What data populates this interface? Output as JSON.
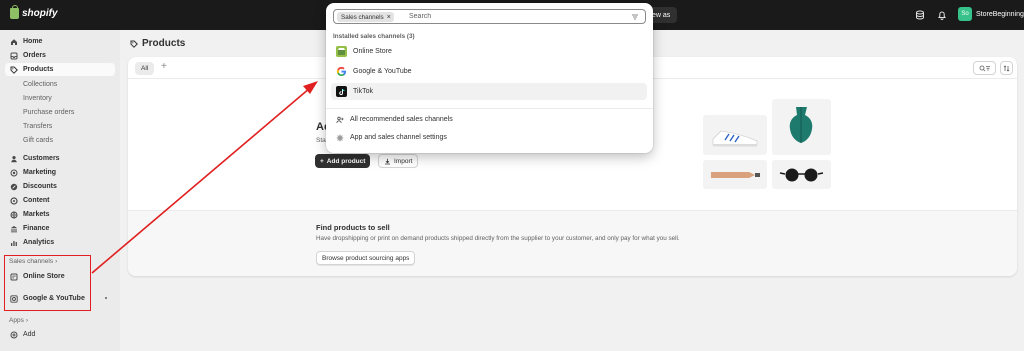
{
  "topbar": {
    "brand": "shopify",
    "view_as_label": "ew as",
    "store_name": "StoreBeginning",
    "store_initials": "So"
  },
  "sidebar": {
    "items": [
      {
        "label": "Home",
        "icon": "home-icon"
      },
      {
        "label": "Orders",
        "icon": "inbox-icon"
      },
      {
        "label": "Products",
        "icon": "tag-icon",
        "active": true
      }
    ],
    "product_subitems": [
      "Collections",
      "Inventory",
      "Purchase orders",
      "Transfers",
      "Gift cards"
    ],
    "items2": [
      {
        "label": "Customers",
        "icon": "person-icon"
      },
      {
        "label": "Marketing",
        "icon": "target-icon"
      },
      {
        "label": "Discounts",
        "icon": "discount-icon"
      },
      {
        "label": "Content",
        "icon": "content-icon"
      },
      {
        "label": "Markets",
        "icon": "globe-icon"
      },
      {
        "label": "Finance",
        "icon": "bank-icon"
      },
      {
        "label": "Analytics",
        "icon": "chart-icon"
      }
    ],
    "sales_channels_label": "Sales channels",
    "channels": [
      {
        "label": "Online Store",
        "icon": "store-icon"
      },
      {
        "label": "Google & YouTube",
        "icon": "google-icon"
      }
    ],
    "apps_label": "Apps",
    "add_label": "Add"
  },
  "main": {
    "title": "Products",
    "tab_all": "All",
    "tab_add": "+",
    "empty_title": "Ac",
    "empty_desc": "Sta",
    "add_product": "Add product",
    "import": "Import",
    "find_title": "Find products to sell",
    "find_desc": "Have dropshipping or print on demand products shipped directly from the supplier to your customer, and only pay for what you sell.",
    "browse_button": "Browse product sourcing apps"
  },
  "dropdown": {
    "chip_label": "Sales channels",
    "search_placeholder": "Search",
    "installed_heading": "Installed sales channels (3)",
    "installed": [
      {
        "label": "Online Store",
        "icon": "online-store-logo"
      },
      {
        "label": "Google & YouTube",
        "icon": "google-logo"
      },
      {
        "label": "TikTok",
        "icon": "tiktok-logo"
      }
    ],
    "actions": [
      {
        "label": "All recommended sales channels",
        "icon": "person-plus-icon"
      },
      {
        "label": "App and sales channel settings",
        "icon": "gear-icon"
      }
    ]
  },
  "colors": {
    "annotation_red": "#e02020",
    "topbar": "#1a1a1a",
    "avatar": "#36c28a"
  }
}
